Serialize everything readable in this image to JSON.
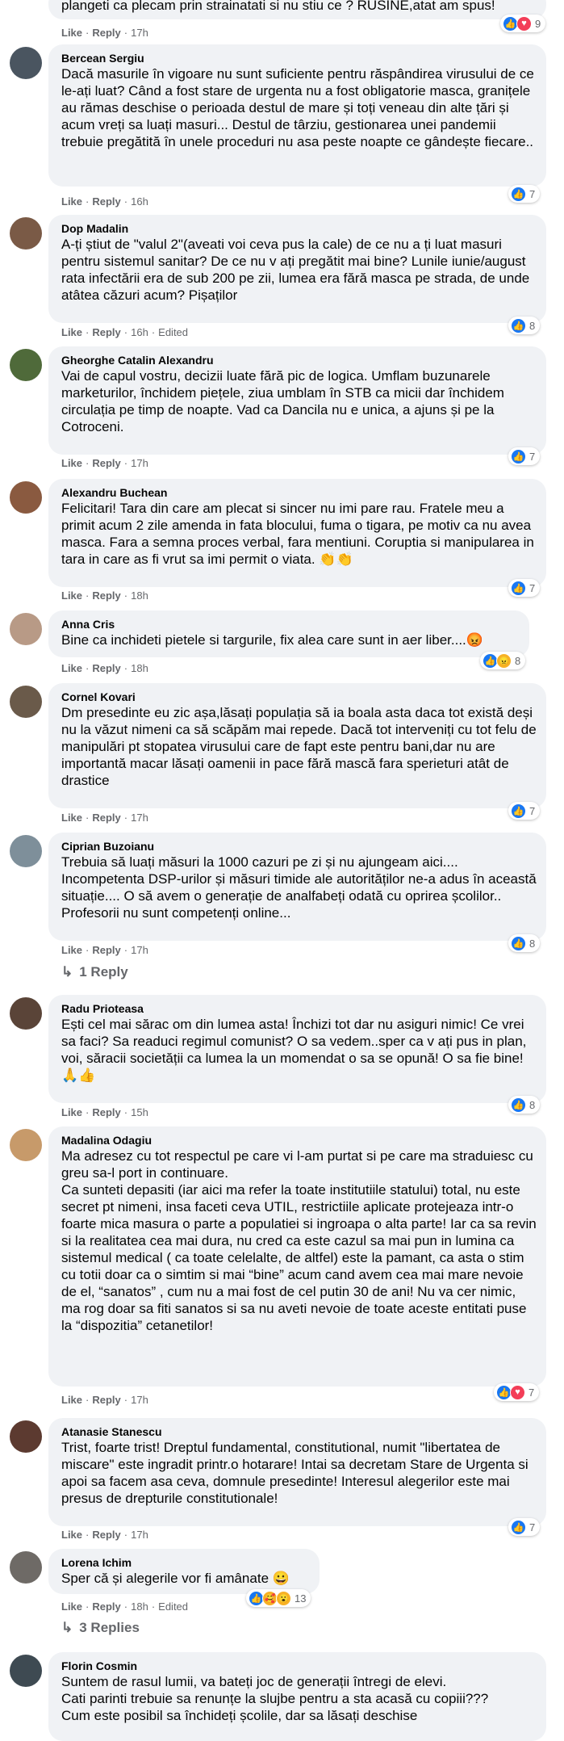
{
  "comments": [
    {
      "author": "",
      "text": "plangeti ca plecam prin strainatati si nu stiu ce ? RUSINE,atat am spus!",
      "like": "Like",
      "reply": "Reply",
      "time": "17h",
      "edited": "",
      "reactions": [
        "like",
        "love"
      ],
      "count": "9"
    },
    {
      "author": "Bercean Sergiu",
      "text": "Dacă masurile în vigoare nu sunt suficiente pentru răspândirea virusului de ce le-ați luat? Când a fost stare de urgenta nu a fost obligatorie masca, granițele au rămas deschise o perioada destul de mare și toți veneau din alte țări și acum vreți sa luați masuri... Destul de târziu, gestionarea unei pandemii trebuie pregătită în unele proceduri nu asa peste noapte ce gândește fiecare..",
      "like": "Like",
      "reply": "Reply",
      "time": "16h",
      "edited": "",
      "reactions": [
        "like"
      ],
      "count": "7"
    },
    {
      "author": "Dop Madalin",
      "text": "A-ți știut de \"valul 2\"(aveati voi ceva pus la cale) de ce nu a ți luat masuri pentru sistemul sanitar? De ce nu v ați pregătit mai bine? Lunile iunie/august rata infectării era de sub 200 pe zii, lumea era fără masca pe strada, de unde atâtea căzuri acum? Pișaților",
      "like": "Like",
      "reply": "Reply",
      "time": "16h",
      "edited": "Edited",
      "reactions": [
        "like"
      ],
      "count": "8"
    },
    {
      "author": "Gheorghe Catalin Alexandru",
      "text": "Vai de capul vostru, decizii luate fără pic de logica. Umflam buzunarele marketurilor, închidem piețele, ziua umblam în STB ca micii dar închidem circulația pe timp de noapte. Vad ca Dancila nu e unica, a ajuns și pe la Cotroceni.",
      "like": "Like",
      "reply": "Reply",
      "time": "17h",
      "edited": "",
      "reactions": [
        "like"
      ],
      "count": "7"
    },
    {
      "author": "Alexandru Buchean",
      "text": "Felicitari! Tara din care am plecat si sincer nu imi pare rau. Fratele meu a primit acum 2 zile amenda in fata blocului, fuma o tigara, pe motiv ca nu avea masca. Fara a semna proces verbal, fara mentiuni. Coruptia si manipularea in tara in care as fi vrut sa imi permit o viata. 👏👏",
      "like": "Like",
      "reply": "Reply",
      "time": "18h",
      "edited": "",
      "reactions": [
        "like"
      ],
      "count": "7"
    },
    {
      "author": "Anna Cris",
      "text": "Bine ca inchideti pietele si targurile, fix alea care sunt in aer liber....😡",
      "like": "Like",
      "reply": "Reply",
      "time": "18h",
      "edited": "",
      "reactions": [
        "like",
        "angry"
      ],
      "count": "8"
    },
    {
      "author": "Cornel Kovari",
      "text": "Dm presedinte eu zic așa,lăsați populația să ia boala asta daca tot există deși nu la văzut nimeni ca să scăpăm mai repede. Dacă tot interveniți cu tot felu de manipulări pt stopatea virusului care de fapt este pentru bani,dar nu are importantă macar lăsați oamenii in pace fără mască fara sperieturi atât de drastice",
      "like": "Like",
      "reply": "Reply",
      "time": "17h",
      "edited": "",
      "reactions": [
        "like"
      ],
      "count": "7"
    },
    {
      "author": "Ciprian Buzoianu",
      "text": "Trebuia să luați măsuri la 1000 cazuri pe zi și nu ajungeam aici.... Incompetenta DSP-urilor și măsuri timide ale autorităților ne-a adus în această situație.... O să avem o generație de analfabeți odată cu oprirea școlilor.. Profesorii nu sunt competenți online...",
      "like": "Like",
      "reply": "Reply",
      "time": "17h",
      "edited": "",
      "reactions": [
        "like"
      ],
      "count": "8",
      "replies": "1 Reply"
    },
    {
      "author": "Radu Prioteasa",
      "text": "Ești cel mai sărac om din lumea asta! Închizi tot dar nu asiguri nimic! Ce vrei sa faci? Sa readuci regimul comunist? O sa vedem..sper ca v ați pus in plan, voi, săracii societății ca lumea la un momendat o sa se opună! O sa fie bine! 🙏👍",
      "like": "Like",
      "reply": "Reply",
      "time": "15h",
      "edited": "",
      "reactions": [
        "like"
      ],
      "count": "8"
    },
    {
      "author": "Madalina Odagiu",
      "text": "Ma adresez cu tot respectul pe care vi l-am purtat si pe care ma straduiesc cu greu sa-l port in continuare.\nCa sunteti depasiti (iar aici ma refer la toate institutiile statului) total, nu este secret pt nimeni, insa faceti ceva UTIL, restrictiile aplicate protejeaza intr-o foarte mica masura o parte a populatiei si ingroapa o alta parte! Iar ca sa revin si la realitatea cea mai dura, nu cred ca este cazul sa mai pun in lumina ca sistemul medical ( ca toate celelalte, de altfel) este la pamant, ca asta o stim cu totii doar ca o simtim si mai “bine” acum cand avem cea mai mare nevoie de el, “sanatos” , cum nu a mai fost de cel putin 30 de ani! Nu va cer nimic, ma rog doar sa fiti sanatos si sa nu aveti nevoie de toate aceste entitati puse la “dispozitia” cetanetilor!",
      "like": "Like",
      "reply": "Reply",
      "time": "17h",
      "edited": "",
      "reactions": [
        "like",
        "love"
      ],
      "count": "7"
    },
    {
      "author": "Atanasie Stanescu",
      "text": "Trist, foarte trist! Dreptul fundamental, constitutional, numit \"libertatea de miscare\" este ingradit printr.o hotarare! Intai sa decretam Stare de Urgenta si apoi sa facem asa ceva, domnule presedinte! Interesul alegerilor este mai presus de drepturile constitutionale!",
      "like": "Like",
      "reply": "Reply",
      "time": "17h",
      "edited": "",
      "reactions": [
        "like"
      ],
      "count": "7"
    },
    {
      "author": "Lorena Ichim",
      "text": "Sper că și alegerile vor fi amânate 😀",
      "like": "Like",
      "reply": "Reply",
      "time": "18h",
      "edited": "Edited",
      "reactions": [
        "like",
        "care",
        "wow"
      ],
      "count": "13",
      "replies": "3 Replies"
    },
    {
      "author": "Florin Cosmin",
      "text": "Suntem de rasul lumii, va bateți joc de generații întregi de elevi.\nCati parinti trebuie sa renunțe la slujbe pentru a sta acasă cu copiii???\nCum este posibil sa închideți școlile, dar sa lăsați deschise",
      "like": "",
      "reply": "",
      "time": "",
      "edited": "",
      "reactions": [],
      "count": ""
    }
  ],
  "colors": {
    "bubble": "#f0f2f5",
    "meta": "#65676b",
    "like_blue": "#1877f2",
    "love_red": "#f33e58",
    "reaction_yellow": "#f7b125"
  }
}
